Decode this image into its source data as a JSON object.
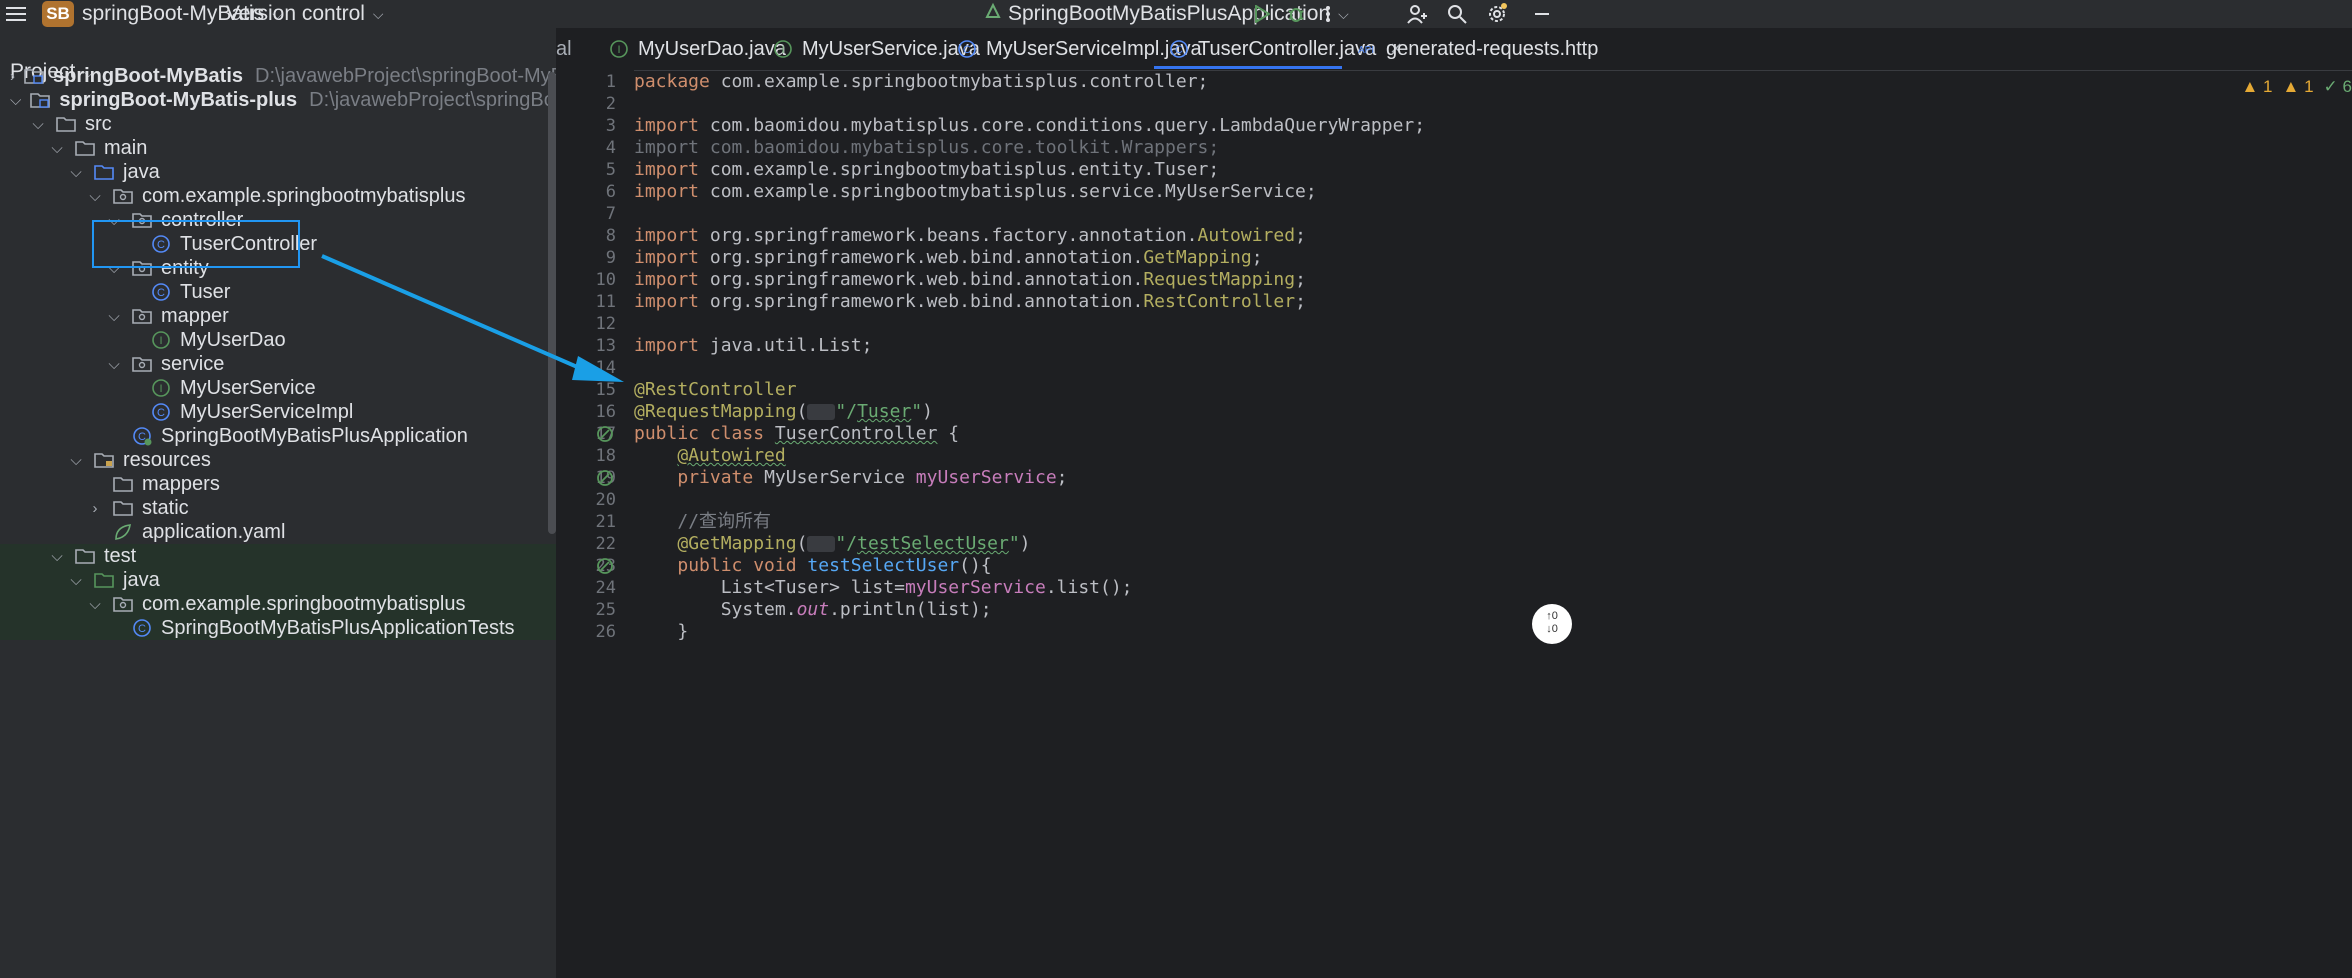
{
  "titlebar": {
    "project_badge": "SB",
    "project_name": "springBoot-MyBatis",
    "vcs_label": "Version control",
    "run_config": "SpringBootMyBatisPlusApplication",
    "icons": [
      "hamburger-menu-icon",
      "run-config-icon",
      "run-icon",
      "debug-icon",
      "more-icon",
      "add-user-icon",
      "search-icon",
      "settings-icon",
      "minimize-icon"
    ]
  },
  "project_panel": {
    "header": "Project",
    "tree": [
      {
        "label": "springBoot-MyBatis",
        "hint": "D:\\javawebProject\\springBoot-MyBatis",
        "icon": "module-folder",
        "chevron": "right",
        "bold": true
      },
      {
        "label": "springBoot-MyBatis-plus",
        "hint": "D:\\javawebProject\\springBoot-MyBatis-plus",
        "icon": "module-folder",
        "chevron": "down",
        "bold": true
      },
      {
        "label": "src",
        "icon": "folder",
        "chevron": "down"
      },
      {
        "label": "main",
        "icon": "folder",
        "chevron": "down"
      },
      {
        "label": "java",
        "icon": "source-folder",
        "chevron": "down"
      },
      {
        "label": "com.example.springbootmybatisplus",
        "icon": "package",
        "chevron": "down"
      },
      {
        "label": "controller",
        "icon": "package",
        "chevron": "down"
      },
      {
        "label": "TuserController",
        "icon": "class"
      },
      {
        "label": "entity",
        "icon": "package",
        "chevron": "down"
      },
      {
        "label": "Tuser",
        "icon": "class"
      },
      {
        "label": "mapper",
        "icon": "package",
        "chevron": "down"
      },
      {
        "label": "MyUserDao",
        "icon": "interface"
      },
      {
        "label": "service",
        "icon": "package",
        "chevron": "down"
      },
      {
        "label": "MyUserService",
        "icon": "interface"
      },
      {
        "label": "MyUserServiceImpl",
        "icon": "class"
      },
      {
        "label": "SpringBootMyBatisPlusApplication",
        "icon": "spring-class"
      },
      {
        "label": "resources",
        "icon": "resources-folder",
        "chevron": "down"
      },
      {
        "label": "mappers",
        "icon": "folder"
      },
      {
        "label": "static",
        "icon": "folder",
        "chevron": "right"
      },
      {
        "label": "application.yaml",
        "icon": "yaml"
      },
      {
        "label": "test",
        "icon": "folder",
        "chevron": "down",
        "green": true
      },
      {
        "label": "java",
        "icon": "test-folder",
        "chevron": "down",
        "green": true
      },
      {
        "label": "com.example.springbootmybatisplus",
        "icon": "package",
        "chevron": "down",
        "green": true
      },
      {
        "label": "SpringBootMyBatisPlusApplicationTests",
        "icon": "class",
        "green": true
      }
    ]
  },
  "tabs": [
    {
      "label": "MyUserDao.java",
      "icon": "interface"
    },
    {
      "label": "MyUserService.java",
      "icon": "interface"
    },
    {
      "label": "MyUserServiceImpl.java",
      "icon": "class"
    },
    {
      "label": "TuserController.java",
      "icon": "class",
      "active": true
    },
    {
      "label": "generated-requests.http",
      "icon": "api"
    }
  ],
  "tab_fragment": "al",
  "inspections": {
    "errors": "1",
    "warnings": "1",
    "ok": "6"
  },
  "vcs_widget": {
    "up": "↑0",
    "down": "↓0"
  },
  "editor": {
    "lines": [
      {
        "n": "1",
        "segs": [
          [
            "kw",
            "package "
          ],
          [
            "",
            "com.example.springbootmybatisplus.controller;"
          ]
        ]
      },
      {
        "n": "2",
        "segs": []
      },
      {
        "n": "3",
        "segs": [
          [
            "kw",
            "import "
          ],
          [
            "",
            "com.baomidou.mybatisplus.core.conditions.query.LambdaQueryWrapper;"
          ]
        ]
      },
      {
        "n": "4",
        "segs": [
          [
            "dim",
            "import com.baomidou.mybatisplus.core.toolkit.Wrappers;"
          ]
        ]
      },
      {
        "n": "5",
        "segs": [
          [
            "kw",
            "import "
          ],
          [
            "",
            "com.example.springbootmybatisplus.entity.Tuser;"
          ]
        ]
      },
      {
        "n": "6",
        "segs": [
          [
            "kw",
            "import "
          ],
          [
            "",
            "com.example.springbootmybatisplus.service.MyUserService;"
          ]
        ]
      },
      {
        "n": "7",
        "segs": []
      },
      {
        "n": "8",
        "segs": [
          [
            "kw",
            "import "
          ],
          [
            "",
            "org.springframework.beans.factory.annotation."
          ],
          [
            "ann",
            "Autowired"
          ],
          [
            "",
            ";"
          ]
        ]
      },
      {
        "n": "9",
        "segs": [
          [
            "kw",
            "import "
          ],
          [
            "",
            "org.springframework.web.bind.annotation."
          ],
          [
            "ann",
            "GetMapping"
          ],
          [
            "",
            ";"
          ]
        ]
      },
      {
        "n": "10",
        "segs": [
          [
            "kw",
            "import "
          ],
          [
            "",
            "org.springframework.web.bind.annotation."
          ],
          [
            "ann",
            "RequestMapping"
          ],
          [
            "",
            ";"
          ]
        ]
      },
      {
        "n": "11",
        "segs": [
          [
            "kw",
            "import "
          ],
          [
            "",
            "org.springframework.web.bind.annotation."
          ],
          [
            "ann",
            "RestController"
          ],
          [
            "",
            ";"
          ]
        ]
      },
      {
        "n": "12",
        "segs": []
      },
      {
        "n": "13",
        "segs": [
          [
            "kw",
            "import "
          ],
          [
            "",
            "java.util.List;"
          ]
        ]
      },
      {
        "n": "14",
        "segs": []
      },
      {
        "n": "15",
        "segs": [
          [
            "ann",
            "@RestController"
          ]
        ]
      },
      {
        "n": "16",
        "segs": [
          [
            "ann",
            "@RequestMapping"
          ],
          [
            "",
            "("
          ],
          [
            "globe",
            ""
          ],
          [
            "str",
            "\"/"
          ],
          [
            "str uline",
            "Tuser"
          ],
          [
            "str",
            "\""
          ],
          [
            "",
            ")"
          ]
        ]
      },
      {
        "n": "17",
        "segs": [
          [
            "kw",
            "public class "
          ],
          [
            "uline",
            "TuserController"
          ],
          [
            "",
            " {"
          ]
        ]
      },
      {
        "n": "18",
        "segs": [
          [
            "",
            "    "
          ],
          [
            "ann uline",
            "@Autowired"
          ]
        ]
      },
      {
        "n": "19",
        "segs": [
          [
            "",
            "    "
          ],
          [
            "kw",
            "private "
          ],
          [
            "",
            "MyUserService "
          ],
          [
            "fld",
            "myUserService"
          ],
          [
            "",
            ";"
          ]
        ]
      },
      {
        "n": "20",
        "segs": []
      },
      {
        "n": "21",
        "segs": [
          [
            "",
            "    "
          ],
          [
            "cmt",
            "//查询所有"
          ]
        ]
      },
      {
        "n": "22",
        "segs": [
          [
            "",
            "    "
          ],
          [
            "ann",
            "@GetMapping"
          ],
          [
            "",
            "("
          ],
          [
            "globe",
            ""
          ],
          [
            "str",
            "\"/"
          ],
          [
            "str uline",
            "testSelectUser"
          ],
          [
            "str",
            "\""
          ],
          [
            "",
            ")"
          ]
        ]
      },
      {
        "n": "23",
        "segs": [
          [
            "",
            "    "
          ],
          [
            "kw",
            "public void "
          ],
          [
            "mth",
            "testSelectUser"
          ],
          [
            "",
            "(){"
          ]
        ]
      },
      {
        "n": "24",
        "segs": [
          [
            "",
            "        List<Tuser> list="
          ],
          [
            "fld",
            "myUserService"
          ],
          [
            "",
            ".list();"
          ]
        ]
      },
      {
        "n": "25",
        "segs": [
          [
            "",
            "        System."
          ],
          [
            "fld ital",
            "out"
          ],
          [
            "",
            ".println(list);"
          ]
        ]
      },
      {
        "n": "26",
        "segs": [
          [
            "",
            "    }"
          ]
        ]
      }
    ]
  }
}
